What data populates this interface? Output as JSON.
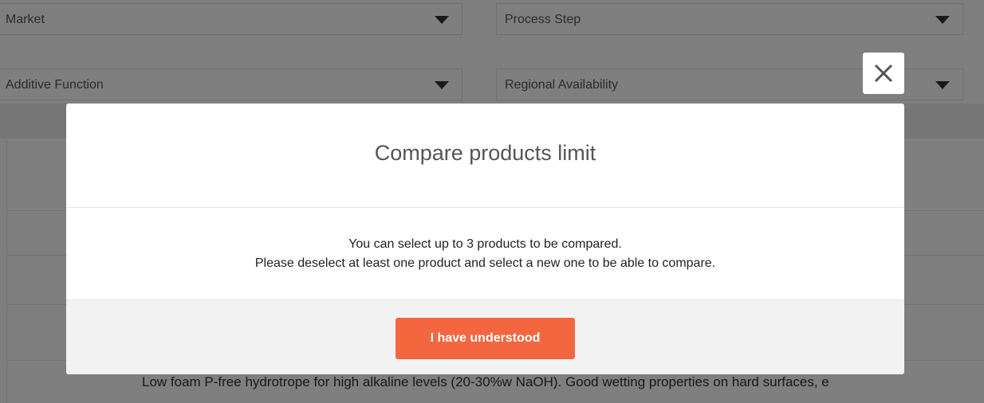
{
  "filters": {
    "market": "Market",
    "process_step": "Process Step",
    "additive_function": "Additive Function",
    "regional_availability": "Regional Availability"
  },
  "background": {
    "product_description": "Low foam P-free hydrotrope for high alkaline levels (20-30%w NaOH). Good wetting properties on hard surfaces, e"
  },
  "modal": {
    "title": "Compare products limit",
    "message_line1": "You can select up to 3 products to be compared.",
    "message_line2": "Please deselect at least one product and select a new one to be able to compare.",
    "confirm_label": "I have understood"
  },
  "colors": {
    "accent": "#f4663f",
    "overlay": "rgba(0,0,0,0.5)"
  },
  "icons": {
    "close": "close-icon",
    "dropdown": "caret-down-icon"
  }
}
